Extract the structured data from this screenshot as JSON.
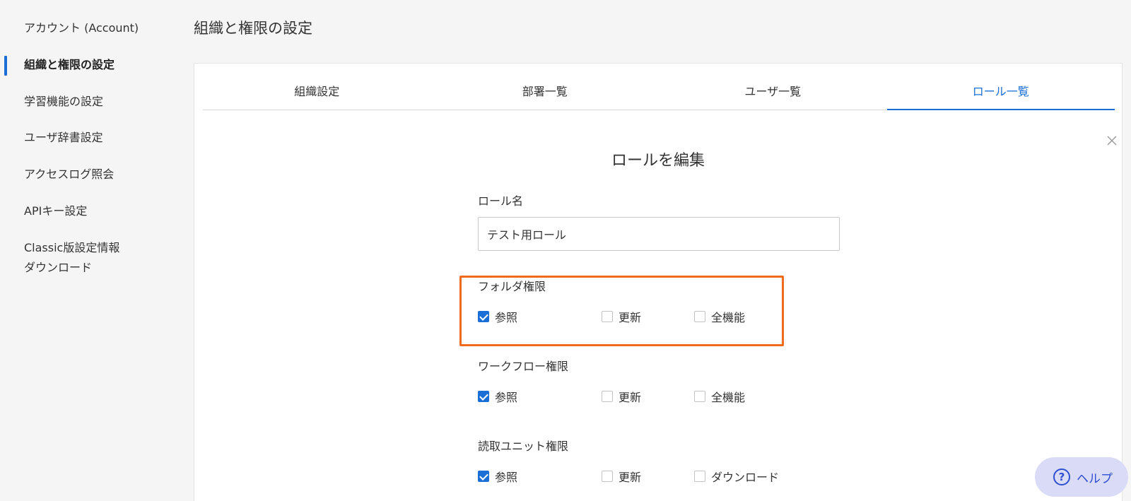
{
  "sidebar": {
    "items": [
      {
        "label": "アカウント (Account)"
      },
      {
        "label": "組織と権限の設定"
      },
      {
        "label": "学習機能の設定"
      },
      {
        "label": "ユーザ辞書設定"
      },
      {
        "label": "アクセスログ照会"
      },
      {
        "label": "APIキー設定"
      },
      {
        "label": "Classic版設定情報"
      },
      {
        "label": "ダウンロード"
      }
    ],
    "active_index": 1
  },
  "page": {
    "title": "組織と権限の設定"
  },
  "tabs": [
    {
      "label": "組織設定"
    },
    {
      "label": "部署一覧"
    },
    {
      "label": "ユーザ一覧"
    },
    {
      "label": "ロール一覧"
    }
  ],
  "active_tab": 3,
  "dialog": {
    "title": "ロールを編集",
    "close_icon": "close-icon",
    "role_name_label": "ロール名",
    "role_name_value": "テスト用ロール",
    "sections": [
      {
        "label": "フォルダ権限",
        "options": [
          {
            "label": "参照",
            "checked": true
          },
          {
            "label": "更新",
            "checked": false
          },
          {
            "label": "全機能",
            "checked": false
          }
        ]
      },
      {
        "label": "ワークフロー権限",
        "options": [
          {
            "label": "参照",
            "checked": true
          },
          {
            "label": "更新",
            "checked": false
          },
          {
            "label": "全機能",
            "checked": false
          }
        ]
      },
      {
        "label": "読取ユニット権限",
        "options": [
          {
            "label": "参照",
            "checked": true
          },
          {
            "label": "更新",
            "checked": false
          },
          {
            "label": "ダウンロード",
            "checked": false
          }
        ]
      }
    ]
  },
  "help": {
    "icon": "help-icon",
    "label": "ヘルプ"
  },
  "colors": {
    "accent": "#1a6fd6",
    "highlight": "#f26b1d",
    "help_bg": "#d9dbf7",
    "help_fg": "#2f4fd1"
  }
}
